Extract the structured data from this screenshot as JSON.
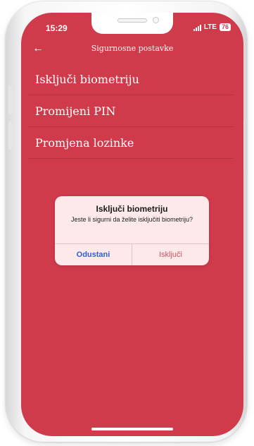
{
  "status_bar": {
    "time": "15:29",
    "network": "LTE",
    "battery": "76"
  },
  "header": {
    "back_icon": "←",
    "title": "Sigurnosne postavke"
  },
  "menu": {
    "items": [
      {
        "label": "Isključi biometriju"
      },
      {
        "label": "Promijeni PIN"
      },
      {
        "label": "Promjena lozinke"
      }
    ]
  },
  "dialog": {
    "title": "Isključi biometriju",
    "message": "Jeste li sigurni da želite isključiti biometriju?",
    "cancel_label": "Odustani",
    "confirm_label": "Isključi"
  },
  "colors": {
    "background": "#cf3b4a",
    "dialog_background": "#fde8ea",
    "cancel_text": "#2f5fd0",
    "confirm_text": "#d0525f"
  },
  "icons": {
    "back": "back-arrow-icon",
    "signal": "signal-bars-icon",
    "battery": "battery-icon"
  }
}
